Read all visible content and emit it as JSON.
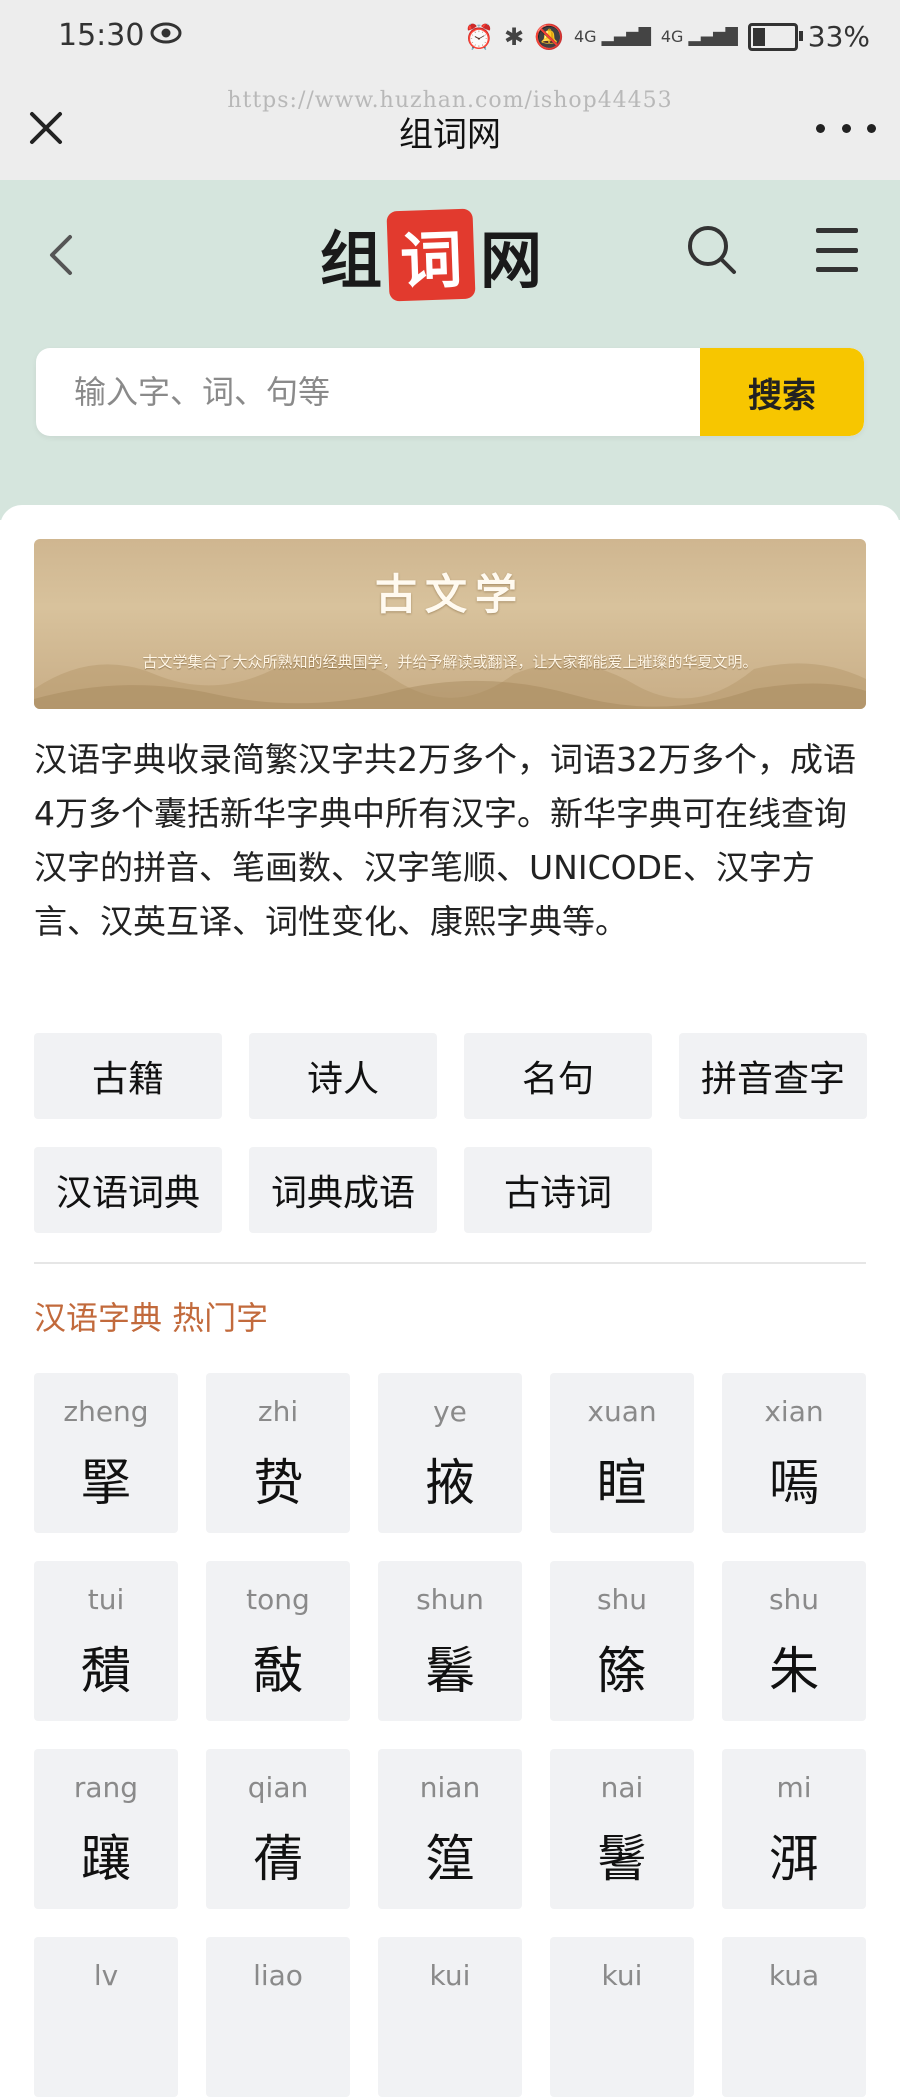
{
  "status_bar": {
    "time": "15:30",
    "battery": "33%",
    "network_1": "4G",
    "network_2": "4G"
  },
  "wechat_bar": {
    "title": "组词网",
    "watermark": "https://www.huzhan.com/ishop44453"
  },
  "site_header": {
    "logo_left": "组",
    "logo_mid": "词",
    "logo_right": "网",
    "search_placeholder": "输入字、词、句等",
    "search_button": "搜索"
  },
  "banner": {
    "title": "古文学",
    "subtitle": "古文学集合了大众所熟知的经典国学，并给予解读或翻译，让大家都能爱上璀璨的华夏文明。"
  },
  "intro": "汉语字典收录简繁汉字共2万多个，词语32万多个，成语4万多个囊括新华字典中所有汉字。新华字典可在线查询汉字的拼音、笔画数、汉字笔顺、UNICODE、汉字方言、汉英互译、词性变化、康熙字典等。",
  "tags": [
    "古籍",
    "诗人",
    "名句",
    "拼音查字",
    "汉语词典",
    "词典成语",
    "古诗词"
  ],
  "section_title": "汉语字典 热门字",
  "hot_chars": [
    {
      "pinyin": "zheng",
      "char": "掔"
    },
    {
      "pinyin": "zhi",
      "char": "贽"
    },
    {
      "pinyin": "ye",
      "char": "掖"
    },
    {
      "pinyin": "xuan",
      "char": "睻"
    },
    {
      "pinyin": "xian",
      "char": "嘕"
    },
    {
      "pinyin": "tui",
      "char": "穨"
    },
    {
      "pinyin": "tong",
      "char": "敽"
    },
    {
      "pinyin": "shun",
      "char": "鬊"
    },
    {
      "pinyin": "shu",
      "char": "篨"
    },
    {
      "pinyin": "shu",
      "char": "朱"
    },
    {
      "pinyin": "rang",
      "char": "躟"
    },
    {
      "pinyin": "qian",
      "char": "蒨"
    },
    {
      "pinyin": "nian",
      "char": "篞"
    },
    {
      "pinyin": "nai",
      "char": "鬐"
    },
    {
      "pinyin": "mi",
      "char": "渳"
    },
    {
      "pinyin": "lv",
      "char": ""
    },
    {
      "pinyin": "liao",
      "char": ""
    },
    {
      "pinyin": "kui",
      "char": ""
    },
    {
      "pinyin": "kui",
      "char": ""
    },
    {
      "pinyin": "kua",
      "char": ""
    }
  ],
  "colors": {
    "hero_bg": "#d5e5dd",
    "search_button": "#f7c600",
    "section_title": "#c26a3c",
    "logo_red": "#e23a2e"
  }
}
